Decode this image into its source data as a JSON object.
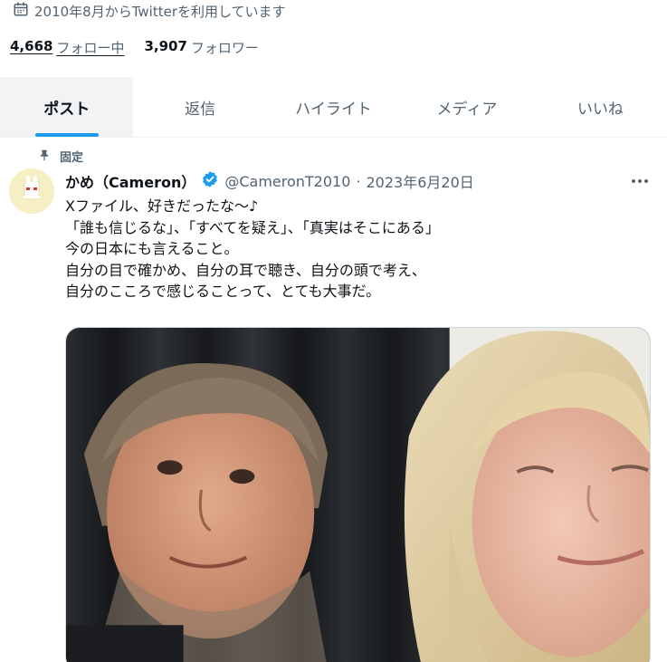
{
  "profile": {
    "joined_text": "2010年8月からTwitterを利用しています",
    "following_count": "4,668",
    "following_label": "フォロー中",
    "followers_count": "3,907",
    "followers_label": "フォロワー"
  },
  "tabs": [
    {
      "label": "ポスト",
      "active": true
    },
    {
      "label": "返信",
      "active": false
    },
    {
      "label": "ハイライト",
      "active": false
    },
    {
      "label": "メディア",
      "active": false
    },
    {
      "label": "いいね",
      "active": false
    }
  ],
  "tweet": {
    "pinned_label": "固定",
    "display_name": "かめ（Cameron）",
    "handle": "@CameronT2010",
    "separator": "·",
    "date": "2023年6月20日",
    "lines": [
      "Xファイル、好きだったな～♪",
      "「誰も信じるな」、「すべてを疑え」、「真実はそこにある」",
      "今の日本にも言えること。",
      "自分の目で確かめ、自分の耳で聴き、自分の頭で考え、",
      "自分のこころで感じることって、とても大事だ。"
    ]
  },
  "colors": {
    "accent": "#1d9bf0",
    "text_primary": "#0f1419",
    "text_secondary": "#536471",
    "active_tab_bg": "#f2f3f4"
  }
}
